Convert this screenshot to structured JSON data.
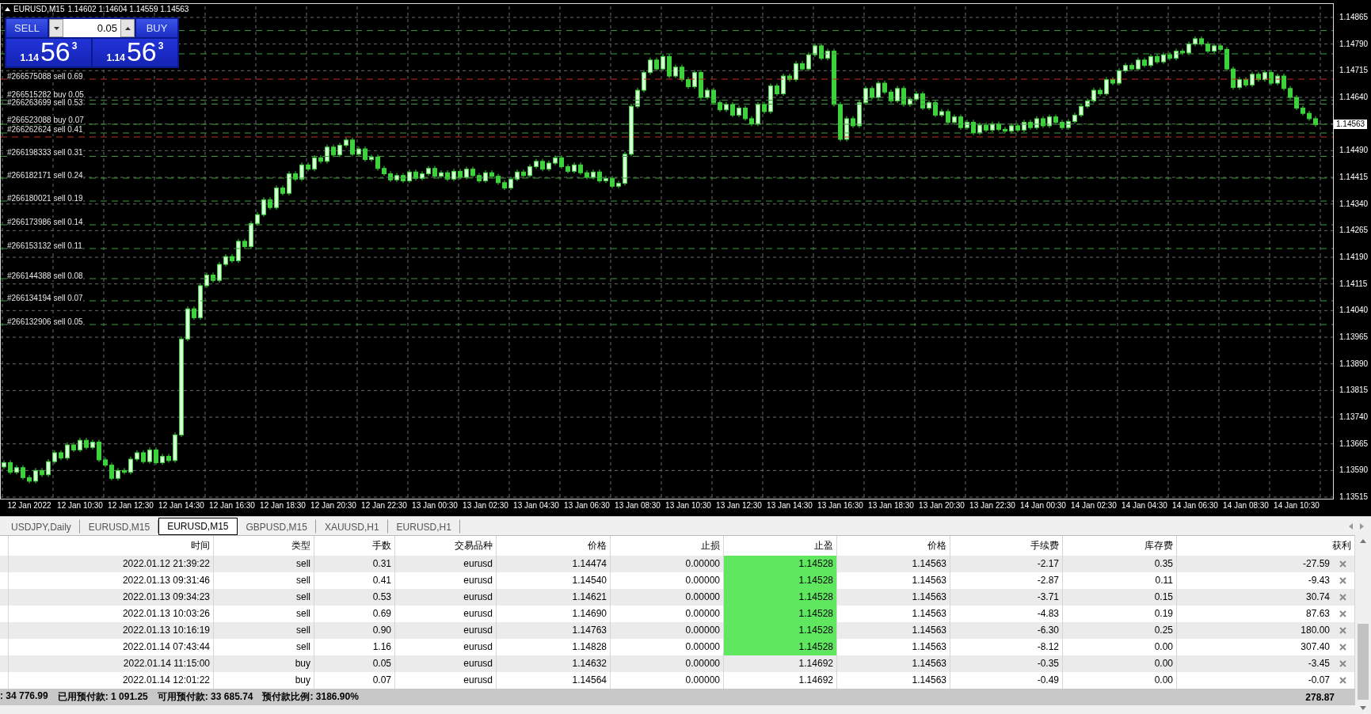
{
  "chart": {
    "symbol": "EURUSD,M15",
    "ohlc": "1.14602 1.14604 1.14559 1.14563",
    "trade_panel": {
      "sell_label": "SELL",
      "buy_label": "BUY",
      "lot": "0.05",
      "bid": {
        "prefix": "1.14",
        "pips": "56",
        "point": "3"
      },
      "ask": {
        "prefix": "1.14",
        "pips": "56",
        "point": "3"
      }
    },
    "order_labels": [
      "#266575088 sell 0.69",
      "#266515282 buy 0.05",
      "#266263699 sell 0.53",
      "#266523088 buy 0.07",
      "#266262624 sell 0.41",
      "#266198333 sell 0.31",
      "#266182171 sell 0.24",
      "#266180021 sell 0.19",
      "#266173986 sell 0.14",
      "#266153132 sell 0.11",
      "#266144388 sell 0.08",
      "#266134194 sell 0.07",
      "#266132906 sell 0.05"
    ],
    "current_price": "1.14563",
    "chart_data": {
      "type": "candlestick",
      "ylim": [
        1.13515,
        1.14865
      ],
      "grid": true,
      "yticks": [
        {
          "value": 1.14865,
          "label": "1.14865"
        },
        {
          "value": 1.1479,
          "label": "1.14790"
        },
        {
          "value": 1.14715,
          "label": "1.14715"
        },
        {
          "value": 1.1464,
          "label": "1.14640"
        },
        {
          "value": 1.1449,
          "label": "1.14490"
        },
        {
          "value": 1.14415,
          "label": "1.14415"
        },
        {
          "value": 1.1434,
          "label": "1.14340"
        },
        {
          "value": 1.14265,
          "label": "1.14265"
        },
        {
          "value": 1.1419,
          "label": "1.14190"
        },
        {
          "value": 1.14115,
          "label": "1.14115"
        },
        {
          "value": 1.1404,
          "label": "1.14040"
        },
        {
          "value": 1.13965,
          "label": "1.13965"
        },
        {
          "value": 1.1389,
          "label": "1.13890"
        },
        {
          "value": 1.13815,
          "label": "1.13815"
        },
        {
          "value": 1.1374,
          "label": "1.13740"
        },
        {
          "value": 1.13665,
          "label": "1.13665"
        },
        {
          "value": 1.1359,
          "label": "1.13590"
        },
        {
          "value": 1.13515,
          "label": "1.13515"
        }
      ],
      "categories": [
        null,
        null,
        null,
        null,
        "12 Jan 2022",
        null,
        null,
        null,
        null,
        null,
        null,
        null,
        "12 Jan 10:30",
        null,
        null,
        null,
        null,
        null,
        null,
        null,
        "12 Jan 12:30",
        null,
        null,
        null,
        null,
        null,
        null,
        null,
        "12 Jan 14:30",
        null,
        null,
        null,
        null,
        null,
        null,
        null,
        "12 Jan 16:30",
        null,
        null,
        null,
        null,
        null,
        null,
        null,
        "12 Jan 18:30",
        null,
        null,
        null,
        null,
        null,
        null,
        null,
        "12 Jan 20:30",
        null,
        null,
        null,
        null,
        null,
        null,
        null,
        "12 Jan 22:30",
        null,
        null,
        null,
        null,
        null,
        null,
        null,
        "13 Jan 00:30",
        null,
        null,
        null,
        null,
        null,
        null,
        null,
        "13 Jan 02:30",
        null,
        null,
        null,
        null,
        null,
        null,
        null,
        "13 Jan 04:30",
        null,
        null,
        null,
        null,
        null,
        null,
        null,
        "13 Jan 06:30",
        null,
        null,
        null,
        null,
        null,
        null,
        null,
        "13 Jan 08:30",
        null,
        null,
        null,
        null,
        null,
        null,
        null,
        "13 Jan 10:30",
        null,
        null,
        null,
        null,
        null,
        null,
        null,
        "13 Jan 12:30",
        null,
        null,
        null,
        null,
        null,
        null,
        null,
        "13 Jan 14:30",
        null,
        null,
        null,
        null,
        null,
        null,
        null,
        "13 Jan 16:30",
        null,
        null,
        null,
        null,
        null,
        null,
        null,
        "13 Jan 18:30",
        null,
        null,
        null,
        null,
        null,
        null,
        null,
        "13 Jan 20:30",
        null,
        null,
        null,
        null,
        null,
        null,
        null,
        "13 Jan 22:30",
        null,
        null,
        null,
        null,
        null,
        null,
        null,
        "14 Jan 00:30",
        null,
        null,
        null,
        null,
        null,
        null,
        null,
        "14 Jan 02:30",
        null,
        null,
        null,
        null,
        null,
        null,
        null,
        "14 Jan 04:30",
        null,
        null,
        null,
        null,
        null,
        null,
        null,
        "14 Jan 06:30",
        null,
        null,
        null,
        null,
        null,
        null,
        null,
        "14 Jan 08:30",
        null,
        null,
        null,
        null,
        null,
        null,
        null,
        "14 Jan 10:30",
        null,
        null,
        null
      ],
      "ohlc": [
        [
          1.136,
          1.13619,
          1.13594,
          1.13612
        ],
        [
          1.13612,
          1.13619,
          1.13579,
          1.13585
        ],
        [
          1.13585,
          1.13605,
          1.13579,
          1.13598
        ],
        [
          1.13598,
          1.13605,
          1.13564,
          1.1357
        ],
        [
          1.1357,
          1.13577,
          1.13554,
          1.1356
        ],
        [
          1.1356,
          1.13597,
          1.13554,
          1.1359
        ],
        [
          1.1359,
          1.13597,
          1.13572,
          1.13578
        ],
        [
          1.13578,
          1.13622,
          1.13572,
          1.13615
        ],
        [
          1.13615,
          1.13647,
          1.13609,
          1.1364
        ],
        [
          1.1364,
          1.13647,
          1.13619,
          1.13625
        ],
        [
          1.13625,
          1.13669,
          1.13619,
          1.13662
        ],
        [
          1.13662,
          1.13669,
          1.13642,
          1.13648
        ],
        [
          1.13648,
          1.13682,
          1.13642,
          1.13675
        ],
        [
          1.13675,
          1.13682,
          1.13649,
          1.13655
        ],
        [
          1.13655,
          1.13677,
          1.13649,
          1.1367
        ],
        [
          1.1367,
          1.13677,
          1.13614,
          1.1362
        ],
        [
          1.1362,
          1.13627,
          1.13599,
          1.13605
        ],
        [
          1.13605,
          1.13612,
          1.13562,
          1.13568
        ],
        [
          1.13568,
          1.13597,
          1.13562,
          1.1359
        ],
        [
          1.1359,
          1.13597,
          1.13579,
          1.13585
        ],
        [
          1.13585,
          1.13629,
          1.13579,
          1.13622
        ],
        [
          1.13622,
          1.13647,
          1.13616,
          1.1364
        ],
        [
          1.1364,
          1.13647,
          1.13609,
          1.13615
        ],
        [
          1.13615,
          1.13655,
          1.13609,
          1.13648
        ],
        [
          1.13648,
          1.13655,
          1.13606,
          1.13612
        ],
        [
          1.13612,
          1.13637,
          1.13606,
          1.1363
        ],
        [
          1.1363,
          1.13637,
          1.13612,
          1.13618
        ],
        [
          1.13618,
          1.13697,
          1.13612,
          1.1369
        ],
        [
          1.1369,
          1.13967,
          1.13684,
          1.1396
        ],
        [
          1.1396,
          1.14052,
          1.13954,
          1.14045
        ],
        [
          1.14045,
          1.14052,
          1.14014,
          1.1402
        ],
        [
          1.1402,
          1.14117,
          1.14014,
          1.1411
        ],
        [
          1.1411,
          1.14147,
          1.14104,
          1.1414
        ],
        [
          1.1414,
          1.14147,
          1.14119,
          1.14125
        ],
        [
          1.14125,
          1.14177,
          1.14119,
          1.1417
        ],
        [
          1.1417,
          1.14199,
          1.14164,
          1.14192
        ],
        [
          1.14192,
          1.14199,
          1.14174,
          1.1418
        ],
        [
          1.1418,
          1.14242,
          1.14174,
          1.14235
        ],
        [
          1.14235,
          1.14242,
          1.14214,
          1.1422
        ],
        [
          1.1422,
          1.14292,
          1.14214,
          1.14285
        ],
        [
          1.14285,
          1.14317,
          1.14279,
          1.1431
        ],
        [
          1.1431,
          1.14359,
          1.14304,
          1.14352
        ],
        [
          1.14352,
          1.14359,
          1.14324,
          1.1433
        ],
        [
          1.1433,
          1.14392,
          1.14324,
          1.14385
        ],
        [
          1.14385,
          1.14392,
          1.14364,
          1.1437
        ],
        [
          1.1437,
          1.14432,
          1.14364,
          1.14425
        ],
        [
          1.14425,
          1.14432,
          1.14404,
          1.1441
        ],
        [
          1.1441,
          1.14457,
          1.14404,
          1.1445
        ],
        [
          1.1445,
          1.14457,
          1.14432,
          1.14438
        ],
        [
          1.14438,
          1.14477,
          1.14432,
          1.1447
        ],
        [
          1.1447,
          1.14477,
          1.14454,
          1.1446
        ],
        [
          1.1446,
          1.14507,
          1.14454,
          1.145
        ],
        [
          1.145,
          1.14507,
          1.14472,
          1.14478
        ],
        [
          1.14478,
          1.14512,
          1.14472,
          1.14505
        ],
        [
          1.14505,
          1.14527,
          1.14499,
          1.1452
        ],
        [
          1.1452,
          1.14527,
          1.14474,
          1.1448
        ],
        [
          1.1448,
          1.14502,
          1.14474,
          1.14495
        ],
        [
          1.14495,
          1.14502,
          1.14459,
          1.14465
        ],
        [
          1.14465,
          1.14479,
          1.14459,
          1.14472
        ],
        [
          1.14472,
          1.14479,
          1.14434,
          1.1444
        ],
        [
          1.1444,
          1.14447,
          1.14419,
          1.14425
        ],
        [
          1.14425,
          1.14432,
          1.14402,
          1.14408
        ],
        [
          1.14408,
          1.14427,
          1.14402,
          1.1442
        ],
        [
          1.1442,
          1.14427,
          1.14399,
          1.14405
        ],
        [
          1.14405,
          1.14437,
          1.14399,
          1.1443
        ],
        [
          1.1443,
          1.14437,
          1.14406,
          1.14412
        ],
        [
          1.14412,
          1.14432,
          1.14406,
          1.14425
        ],
        [
          1.14425,
          1.14447,
          1.14419,
          1.1444
        ],
        [
          1.1444,
          1.14447,
          1.14412,
          1.14418
        ],
        [
          1.14418,
          1.14435,
          1.14412,
          1.14428
        ],
        [
          1.14428,
          1.14435,
          1.14404,
          1.1441
        ],
        [
          1.1441,
          1.14439,
          1.14404,
          1.14432
        ],
        [
          1.14432,
          1.14439,
          1.14409,
          1.14415
        ],
        [
          1.14415,
          1.14445,
          1.14409,
          1.14438
        ],
        [
          1.14438,
          1.14445,
          1.14414,
          1.1442
        ],
        [
          1.1442,
          1.14427,
          1.14399,
          1.14405
        ],
        [
          1.14405,
          1.14435,
          1.14399,
          1.14428
        ],
        [
          1.14428,
          1.14435,
          1.14412,
          1.14418
        ],
        [
          1.14418,
          1.14425,
          1.14394,
          1.144
        ],
        [
          1.144,
          1.14407,
          1.14379,
          1.14385
        ],
        [
          1.14385,
          1.14417,
          1.14379,
          1.1441
        ],
        [
          1.1441,
          1.14437,
          1.14404,
          1.1443
        ],
        [
          1.1443,
          1.14437,
          1.14414,
          1.1442
        ],
        [
          1.1442,
          1.14452,
          1.14414,
          1.14445
        ],
        [
          1.14445,
          1.14467,
          1.14439,
          1.1446
        ],
        [
          1.1446,
          1.14467,
          1.14432,
          1.14438
        ],
        [
          1.14438,
          1.14462,
          1.14432,
          1.14455
        ],
        [
          1.14455,
          1.14477,
          1.14449,
          1.1447
        ],
        [
          1.1447,
          1.14477,
          1.14439,
          1.14445
        ],
        [
          1.14445,
          1.14452,
          1.14426,
          1.14432
        ],
        [
          1.14432,
          1.14457,
          1.14426,
          1.1445
        ],
        [
          1.1445,
          1.14457,
          1.14422,
          1.14428
        ],
        [
          1.14428,
          1.14435,
          1.14409,
          1.14415
        ],
        [
          1.14415,
          1.14437,
          1.14409,
          1.1443
        ],
        [
          1.1443,
          1.14437,
          1.14399,
          1.14405
        ],
        [
          1.14405,
          1.14419,
          1.14399,
          1.14412
        ],
        [
          1.14412,
          1.14419,
          1.14384,
          1.1439
        ],
        [
          1.1439,
          1.14405,
          1.14384,
          1.14398
        ],
        [
          1.14398,
          1.14487,
          1.14392,
          1.1448
        ],
        [
          1.1448,
          1.14622,
          1.14474,
          1.14615
        ],
        [
          1.14615,
          1.14667,
          1.14609,
          1.1466
        ],
        [
          1.1466,
          1.14717,
          1.14654,
          1.1471
        ],
        [
          1.1471,
          1.14752,
          1.14704,
          1.14745
        ],
        [
          1.14745,
          1.14752,
          1.14714,
          1.1472
        ],
        [
          1.1472,
          1.14762,
          1.14714,
          1.14755
        ],
        [
          1.14755,
          1.14762,
          1.14694,
          1.147
        ],
        [
          1.147,
          1.14732,
          1.14694,
          1.14725
        ],
        [
          1.14725,
          1.14732,
          1.14684,
          1.1469
        ],
        [
          1.1469,
          1.14697,
          1.14664,
          1.1467
        ],
        [
          1.1467,
          1.14717,
          1.14664,
          1.1471
        ],
        [
          1.1471,
          1.14717,
          1.14634,
          1.1464
        ],
        [
          1.1464,
          1.14667,
          1.14634,
          1.1466
        ],
        [
          1.1466,
          1.14667,
          1.14619,
          1.14625
        ],
        [
          1.14625,
          1.14632,
          1.14599,
          1.14605
        ],
        [
          1.14605,
          1.14627,
          1.14599,
          1.1462
        ],
        [
          1.1462,
          1.14627,
          1.14584,
          1.1459
        ],
        [
          1.1459,
          1.14617,
          1.14584,
          1.1461
        ],
        [
          1.1461,
          1.14617,
          1.14574,
          1.1458
        ],
        [
          1.1458,
          1.14587,
          1.14559,
          1.14565
        ],
        [
          1.14565,
          1.14627,
          1.14559,
          1.1462
        ],
        [
          1.1462,
          1.14627,
          1.14594,
          1.146
        ],
        [
          1.146,
          1.14679,
          1.14594,
          1.14672
        ],
        [
          1.14672,
          1.14679,
          1.14644,
          1.1465
        ],
        [
          1.1465,
          1.14707,
          1.14644,
          1.147
        ],
        [
          1.147,
          1.14707,
          1.14684,
          1.1469
        ],
        [
          1.1469,
          1.14742,
          1.14684,
          1.14735
        ],
        [
          1.14735,
          1.14742,
          1.14714,
          1.1472
        ],
        [
          1.1472,
          1.14767,
          1.14714,
          1.1476
        ],
        [
          1.1476,
          1.14792,
          1.14754,
          1.14785
        ],
        [
          1.14785,
          1.14792,
          1.14744,
          1.1475
        ],
        [
          1.1475,
          1.14777,
          1.14744,
          1.1477
        ],
        [
          1.1477,
          1.14777,
          1.14614,
          1.1462
        ],
        [
          1.1462,
          1.14627,
          1.14516,
          1.14522
        ],
        [
          1.14522,
          1.14587,
          1.14516,
          1.1458
        ],
        [
          1.1458,
          1.14587,
          1.14554,
          1.1456
        ],
        [
          1.1456,
          1.14632,
          1.14554,
          1.14625
        ],
        [
          1.14625,
          1.14672,
          1.14619,
          1.14665
        ],
        [
          1.14665,
          1.14672,
          1.14634,
          1.1464
        ],
        [
          1.1464,
          1.14687,
          1.14634,
          1.1468
        ],
        [
          1.1468,
          1.14687,
          1.14649,
          1.14655
        ],
        [
          1.14655,
          1.14662,
          1.14624,
          1.1463
        ],
        [
          1.1463,
          1.14672,
          1.14624,
          1.14665
        ],
        [
          1.14665,
          1.14672,
          1.14614,
          1.1462
        ],
        [
          1.1462,
          1.14642,
          1.14614,
          1.14635
        ],
        [
          1.14635,
          1.14657,
          1.14629,
          1.1465
        ],
        [
          1.1465,
          1.14657,
          1.14604,
          1.1461
        ],
        [
          1.1461,
          1.14632,
          1.14604,
          1.14625
        ],
        [
          1.14625,
          1.14632,
          1.14584,
          1.1459
        ],
        [
          1.1459,
          1.14607,
          1.14584,
          1.146
        ],
        [
          1.146,
          1.14607,
          1.14564,
          1.1457
        ],
        [
          1.1457,
          1.14592,
          1.14564,
          1.14585
        ],
        [
          1.14585,
          1.14592,
          1.14549,
          1.14555
        ],
        [
          1.14555,
          1.14577,
          1.14549,
          1.1457
        ],
        [
          1.1457,
          1.14577,
          1.14534,
          1.1454
        ],
        [
          1.1454,
          1.14569,
          1.14534,
          1.14562
        ],
        [
          1.14562,
          1.14569,
          1.14542,
          1.14548
        ],
        [
          1.14548,
          1.14572,
          1.14542,
          1.14565
        ],
        [
          1.14565,
          1.14572,
          1.14544,
          1.1455
        ],
        [
          1.1455,
          1.14557,
          1.14539,
          1.14545
        ],
        [
          1.14545,
          1.14567,
          1.14539,
          1.1456
        ],
        [
          1.1456,
          1.14567,
          1.14542,
          1.14548
        ],
        [
          1.14548,
          1.14577,
          1.14542,
          1.1457
        ],
        [
          1.1457,
          1.14577,
          1.14549,
          1.14555
        ],
        [
          1.14555,
          1.14587,
          1.14549,
          1.1458
        ],
        [
          1.1458,
          1.14587,
          1.14554,
          1.1456
        ],
        [
          1.1456,
          1.14592,
          1.14554,
          1.14585
        ],
        [
          1.14585,
          1.14592,
          1.14564,
          1.1457
        ],
        [
          1.1457,
          1.14577,
          1.14549,
          1.14555
        ],
        [
          1.14555,
          1.14579,
          1.14549,
          1.14572
        ],
        [
          1.14572,
          1.14597,
          1.14566,
          1.1459
        ],
        [
          1.1459,
          1.14622,
          1.14584,
          1.14615
        ],
        [
          1.14615,
          1.14637,
          1.14609,
          1.1463
        ],
        [
          1.1463,
          1.14667,
          1.14624,
          1.1466
        ],
        [
          1.1466,
          1.14667,
          1.14644,
          1.1465
        ],
        [
          1.1465,
          1.14697,
          1.14644,
          1.1469
        ],
        [
          1.1469,
          1.14697,
          1.14674,
          1.1468
        ],
        [
          1.1468,
          1.14722,
          1.14674,
          1.14715
        ],
        [
          1.14715,
          1.14737,
          1.14709,
          1.1473
        ],
        [
          1.1473,
          1.14737,
          1.14714,
          1.1472
        ],
        [
          1.1472,
          1.14752,
          1.14714,
          1.14745
        ],
        [
          1.14745,
          1.14752,
          1.14724,
          1.1473
        ],
        [
          1.1473,
          1.14762,
          1.14724,
          1.14755
        ],
        [
          1.14755,
          1.14762,
          1.14734,
          1.1474
        ],
        [
          1.1474,
          1.14767,
          1.14734,
          1.1476
        ],
        [
          1.1476,
          1.14767,
          1.14744,
          1.1475
        ],
        [
          1.1475,
          1.14777,
          1.14744,
          1.1477
        ],
        [
          1.1477,
          1.14777,
          1.14759,
          1.14765
        ],
        [
          1.14765,
          1.14797,
          1.14759,
          1.1479
        ],
        [
          1.1479,
          1.14812,
          1.14784,
          1.14805
        ],
        [
          1.14805,
          1.14812,
          1.14784,
          1.1479
        ],
        [
          1.1479,
          1.14797,
          1.14764,
          1.1477
        ],
        [
          1.1477,
          1.14792,
          1.14764,
          1.14785
        ],
        [
          1.14785,
          1.14792,
          1.14769,
          1.14775
        ],
        [
          1.14775,
          1.14782,
          1.14714,
          1.1472
        ],
        [
          1.1472,
          1.14727,
          1.14662,
          1.14668
        ],
        [
          1.14668,
          1.14697,
          1.14662,
          1.1469
        ],
        [
          1.1469,
          1.14697,
          1.14669,
          1.14675
        ],
        [
          1.14675,
          1.14712,
          1.14669,
          1.14705
        ],
        [
          1.14705,
          1.14712,
          1.14684,
          1.1469
        ],
        [
          1.1469,
          1.14717,
          1.14684,
          1.1471
        ],
        [
          1.1471,
          1.14717,
          1.14674,
          1.1468
        ],
        [
          1.1468,
          1.14707,
          1.14674,
          1.147
        ],
        [
          1.147,
          1.14707,
          1.14659,
          1.14665
        ],
        [
          1.14665,
          1.14672,
          1.14634,
          1.1464
        ],
        [
          1.1464,
          1.14647,
          1.14604,
          1.1461
        ],
        [
          1.1461,
          1.14617,
          1.14589,
          1.14595
        ],
        [
          1.14595,
          1.14602,
          1.14574,
          1.1458
        ],
        [
          1.1458,
          1.14587,
          1.14557,
          1.14563
        ]
      ]
    }
  },
  "tabs": [
    {
      "label": "USDJPY,Daily",
      "selected": false
    },
    {
      "label": "EURUSD,M15",
      "selected": false
    },
    {
      "label": "EURUSD,M15",
      "selected": true
    },
    {
      "label": "GBPUSD,M15",
      "selected": false
    },
    {
      "label": "XAUUSD,H1",
      "selected": false
    },
    {
      "label": "EURUSD,H1",
      "selected": false
    }
  ],
  "positions": {
    "columns": [
      "时间",
      "类型",
      "手数",
      "交易品种",
      "价格",
      "止损",
      "止盈",
      "价格",
      "手续费",
      "库存费",
      "获利"
    ],
    "rows": [
      {
        "time": "2022.01.12 21:39:22",
        "type": "sell",
        "lots": "0.31",
        "symbol": "eurusd",
        "price": "1.14474",
        "sl": "0.00000",
        "tp": "1.14528",
        "tp_hit": true,
        "current": "1.14563",
        "commission": "-2.17",
        "swap": "0.35",
        "profit": "-27.59"
      },
      {
        "time": "2022.01.13 09:31:46",
        "type": "sell",
        "lots": "0.41",
        "symbol": "eurusd",
        "price": "1.14540",
        "sl": "0.00000",
        "tp": "1.14528",
        "tp_hit": true,
        "current": "1.14563",
        "commission": "-2.87",
        "swap": "0.11",
        "profit": "-9.43"
      },
      {
        "time": "2022.01.13 09:34:23",
        "type": "sell",
        "lots": "0.53",
        "symbol": "eurusd",
        "price": "1.14621",
        "sl": "0.00000",
        "tp": "1.14528",
        "tp_hit": true,
        "current": "1.14563",
        "commission": "-3.71",
        "swap": "0.15",
        "profit": "30.74"
      },
      {
        "time": "2022.01.13 10:03:26",
        "type": "sell",
        "lots": "0.69",
        "symbol": "eurusd",
        "price": "1.14690",
        "sl": "0.00000",
        "tp": "1.14528",
        "tp_hit": true,
        "current": "1.14563",
        "commission": "-4.83",
        "swap": "0.19",
        "profit": "87.63"
      },
      {
        "time": "2022.01.13 10:16:19",
        "type": "sell",
        "lots": "0.90",
        "symbol": "eurusd",
        "price": "1.14763",
        "sl": "0.00000",
        "tp": "1.14528",
        "tp_hit": true,
        "current": "1.14563",
        "commission": "-6.30",
        "swap": "0.25",
        "profit": "180.00"
      },
      {
        "time": "2022.01.14 07:43:44",
        "type": "sell",
        "lots": "1.16",
        "symbol": "eurusd",
        "price": "1.14828",
        "sl": "0.00000",
        "tp": "1.14528",
        "tp_hit": true,
        "current": "1.14563",
        "commission": "-8.12",
        "swap": "0.00",
        "profit": "307.40"
      },
      {
        "time": "2022.01.14 11:15:00",
        "type": "buy",
        "lots": "0.05",
        "symbol": "eurusd",
        "price": "1.14632",
        "sl": "0.00000",
        "tp": "1.14692",
        "tp_hit": false,
        "current": "1.14563",
        "commission": "-0.35",
        "swap": "0.00",
        "profit": "-3.45"
      },
      {
        "time": "2022.01.14 12:01:22",
        "type": "buy",
        "lots": "0.07",
        "symbol": "eurusd",
        "price": "1.14564",
        "sl": "0.00000",
        "tp": "1.14692",
        "tp_hit": false,
        "current": "1.14563",
        "commission": "-0.49",
        "swap": "0.00",
        "profit": "-0.07"
      }
    ],
    "status": [
      ": 34 776.99",
      "已用预付款: 1 091.25",
      "可用预付款: 33 685.74",
      "预付款比例: 3186.90%"
    ],
    "total_profit": "278.87"
  }
}
